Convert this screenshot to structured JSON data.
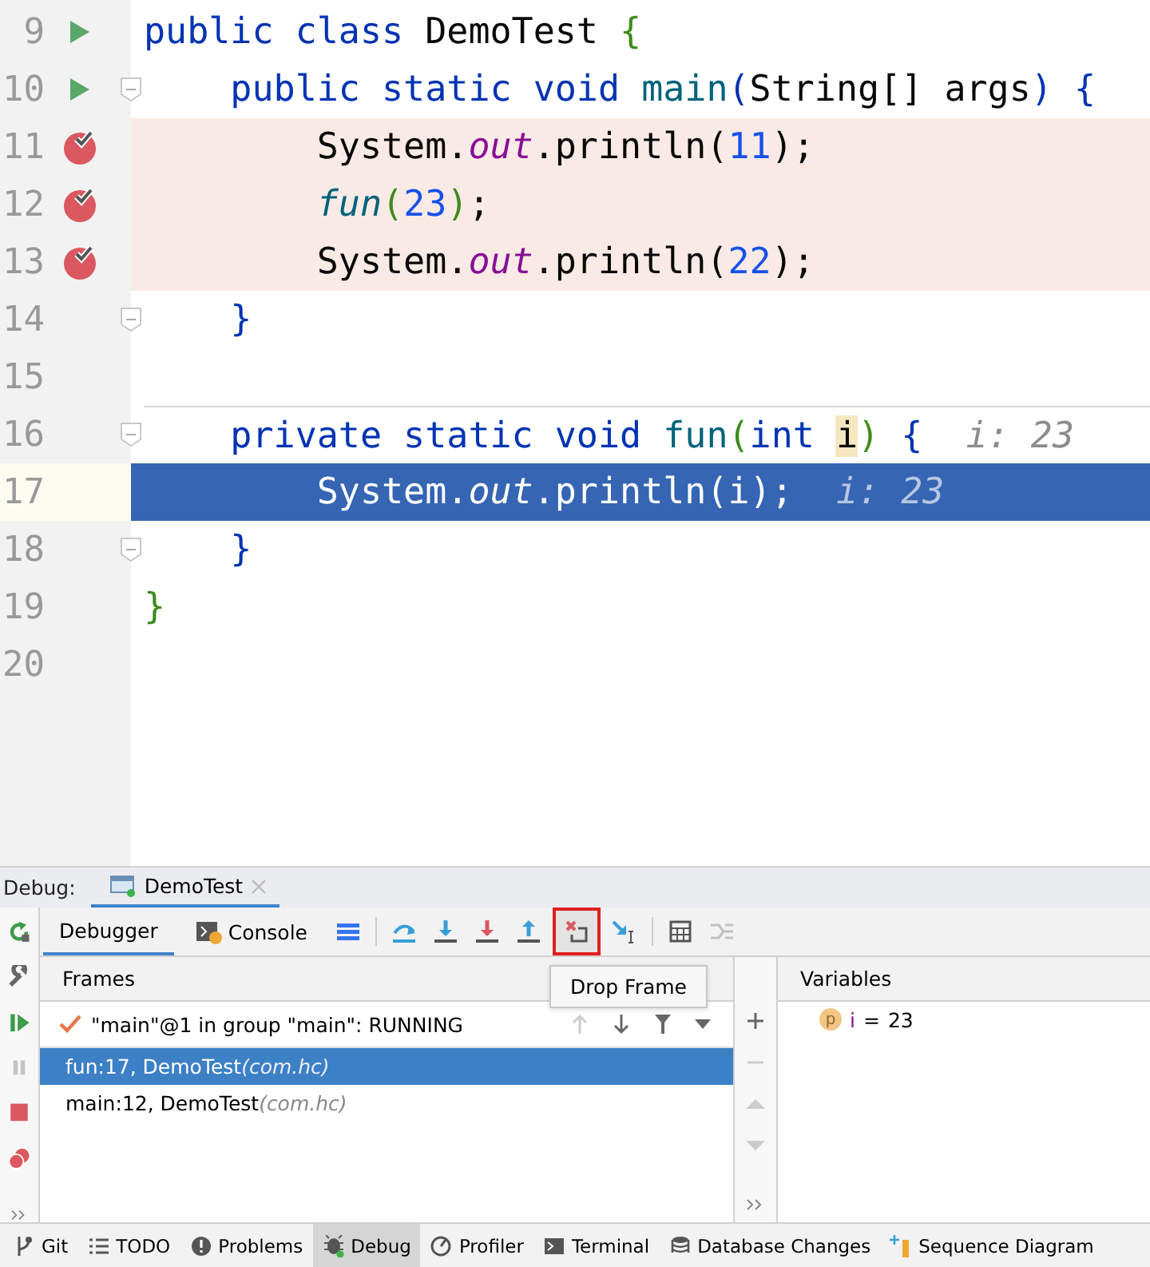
{
  "editor": {
    "lines": [
      {
        "number": "9",
        "runnable": true,
        "breakpoint": false,
        "current": false,
        "fold": false,
        "tokens": [
          {
            "text": "public class ",
            "kind": "kw"
          },
          {
            "text": "DemoTest ",
            "kind": "plain"
          },
          {
            "text": "{",
            "kind": "bracket-a"
          }
        ]
      },
      {
        "number": "10",
        "runnable": true,
        "breakpoint": false,
        "current": false,
        "fold": true,
        "tokens": [
          {
            "text": "    public static void ",
            "kind": "kw"
          },
          {
            "text": "main",
            "kind": "method"
          },
          {
            "text": "(",
            "kind": "bracket-b"
          },
          {
            "text": "String[] args",
            "kind": "plain"
          },
          {
            "text": ")",
            "kind": "bracket-b"
          },
          {
            "text": " {",
            "kind": "kw"
          }
        ]
      },
      {
        "number": "11",
        "runnable": false,
        "breakpoint": true,
        "current": false,
        "fold": false,
        "tokens": [
          {
            "text": "        System.",
            "kind": "plain"
          },
          {
            "text": "out",
            "kind": "field"
          },
          {
            "text": ".println(",
            "kind": "plain"
          },
          {
            "text": "11",
            "kind": "num"
          },
          {
            "text": ");",
            "kind": "plain"
          }
        ]
      },
      {
        "number": "12",
        "runnable": false,
        "breakpoint": true,
        "current": false,
        "fold": false,
        "tokens": [
          {
            "text": "        fun",
            "kind": "call"
          },
          {
            "text": "(",
            "kind": "bracket-a"
          },
          {
            "text": "23",
            "kind": "num"
          },
          {
            "text": ")",
            "kind": "bracket-a"
          },
          {
            "text": ";",
            "kind": "plain"
          }
        ]
      },
      {
        "number": "13",
        "runnable": false,
        "breakpoint": true,
        "current": false,
        "fold": false,
        "tokens": [
          {
            "text": "        System.",
            "kind": "plain"
          },
          {
            "text": "out",
            "kind": "field"
          },
          {
            "text": ".println(",
            "kind": "plain"
          },
          {
            "text": "22",
            "kind": "num"
          },
          {
            "text": ");",
            "kind": "plain"
          }
        ]
      },
      {
        "number": "14",
        "runnable": false,
        "breakpoint": false,
        "current": false,
        "fold": true,
        "tokens": [
          {
            "text": "    }",
            "kind": "kw"
          }
        ]
      },
      {
        "number": "15",
        "runnable": false,
        "breakpoint": false,
        "current": false,
        "fold": false
      },
      {
        "number": "16",
        "runnable": false,
        "breakpoint": false,
        "current": false,
        "fold": true,
        "tokens": [
          {
            "text": "    private static void ",
            "kind": "kw"
          },
          {
            "text": "fun",
            "kind": "method"
          },
          {
            "text": "(",
            "kind": "bracket-a"
          },
          {
            "text": "int ",
            "kind": "kw"
          },
          {
            "text": "i",
            "kind": "param-hit"
          },
          {
            "text": ")",
            "kind": "bracket-a"
          },
          {
            "text": " {",
            "kind": "kw"
          },
          {
            "text": "  i: 23",
            "kind": "hint"
          }
        ]
      },
      {
        "number": "17",
        "runnable": false,
        "breakpoint": false,
        "current": true,
        "fold": false,
        "tokens": [
          {
            "text": "        System.",
            "kind": "plain"
          },
          {
            "text": "out",
            "kind": "field"
          },
          {
            "text": ".println(i);",
            "kind": "plain"
          },
          {
            "text": "  i: 23",
            "kind": "hint"
          }
        ]
      },
      {
        "number": "18",
        "runnable": false,
        "breakpoint": false,
        "current": false,
        "fold": true,
        "tokens": [
          {
            "text": "    }",
            "kind": "kw"
          }
        ]
      },
      {
        "number": "19",
        "runnable": false,
        "breakpoint": false,
        "current": false,
        "fold": false,
        "tokens": [
          {
            "text": "}",
            "kind": "bracket-a"
          }
        ]
      },
      {
        "number": "20",
        "runnable": false,
        "breakpoint": false,
        "current": false,
        "fold": false
      }
    ]
  },
  "debug": {
    "label": "Debug:",
    "session_tabs": [
      {
        "label": "DemoTest",
        "selected": true
      }
    ],
    "view_tabs": [
      {
        "label": "Debugger",
        "kind": "debugger",
        "selected": true
      },
      {
        "label": "Console",
        "kind": "console",
        "selected": false
      }
    ],
    "actions": [
      {
        "kind": "layout",
        "highlighted": false,
        "disabled": false
      },
      {
        "kind": "step-over",
        "highlighted": false,
        "disabled": false
      },
      {
        "kind": "step-into",
        "highlighted": false,
        "disabled": false
      },
      {
        "kind": "force-step-into",
        "highlighted": false,
        "disabled": false
      },
      {
        "kind": "step-out",
        "highlighted": false,
        "disabled": false
      },
      {
        "kind": "drop-frame",
        "highlighted": true,
        "disabled": false
      },
      {
        "kind": "run-to-cursor",
        "highlighted": false,
        "disabled": false
      },
      {
        "kind": "evaluate",
        "highlighted": false,
        "disabled": false
      },
      {
        "kind": "trace",
        "highlighted": false,
        "disabled": true
      }
    ],
    "tooltip": "Drop Frame",
    "frames": {
      "header": "Frames",
      "thread": "\"main\"@1 in group \"main\": RUNNING",
      "items": [
        {
          "location": "fun:17, DemoTest",
          "package": "(com.hc)",
          "selected": true
        },
        {
          "location": "main:12, DemoTest",
          "package": "(com.hc)",
          "selected": false
        }
      ]
    },
    "variables": {
      "header": "Variables",
      "items": [
        {
          "badge": "p",
          "name": "i",
          "separator": "=",
          "value": "23"
        }
      ]
    }
  },
  "tool_windows": [
    {
      "label": "Git",
      "kind": "git",
      "selected": false
    },
    {
      "label": "TODO",
      "kind": "todo",
      "selected": false
    },
    {
      "label": "Problems",
      "kind": "problems",
      "selected": false
    },
    {
      "label": "Debug",
      "kind": "debug",
      "selected": true
    },
    {
      "label": "Profiler",
      "kind": "profiler",
      "selected": false
    },
    {
      "label": "Terminal",
      "kind": "terminal",
      "selected": false
    },
    {
      "label": "Database Changes",
      "kind": "database",
      "selected": false
    },
    {
      "label": "Sequence Diagram",
      "kind": "sequence",
      "selected": false
    }
  ]
}
